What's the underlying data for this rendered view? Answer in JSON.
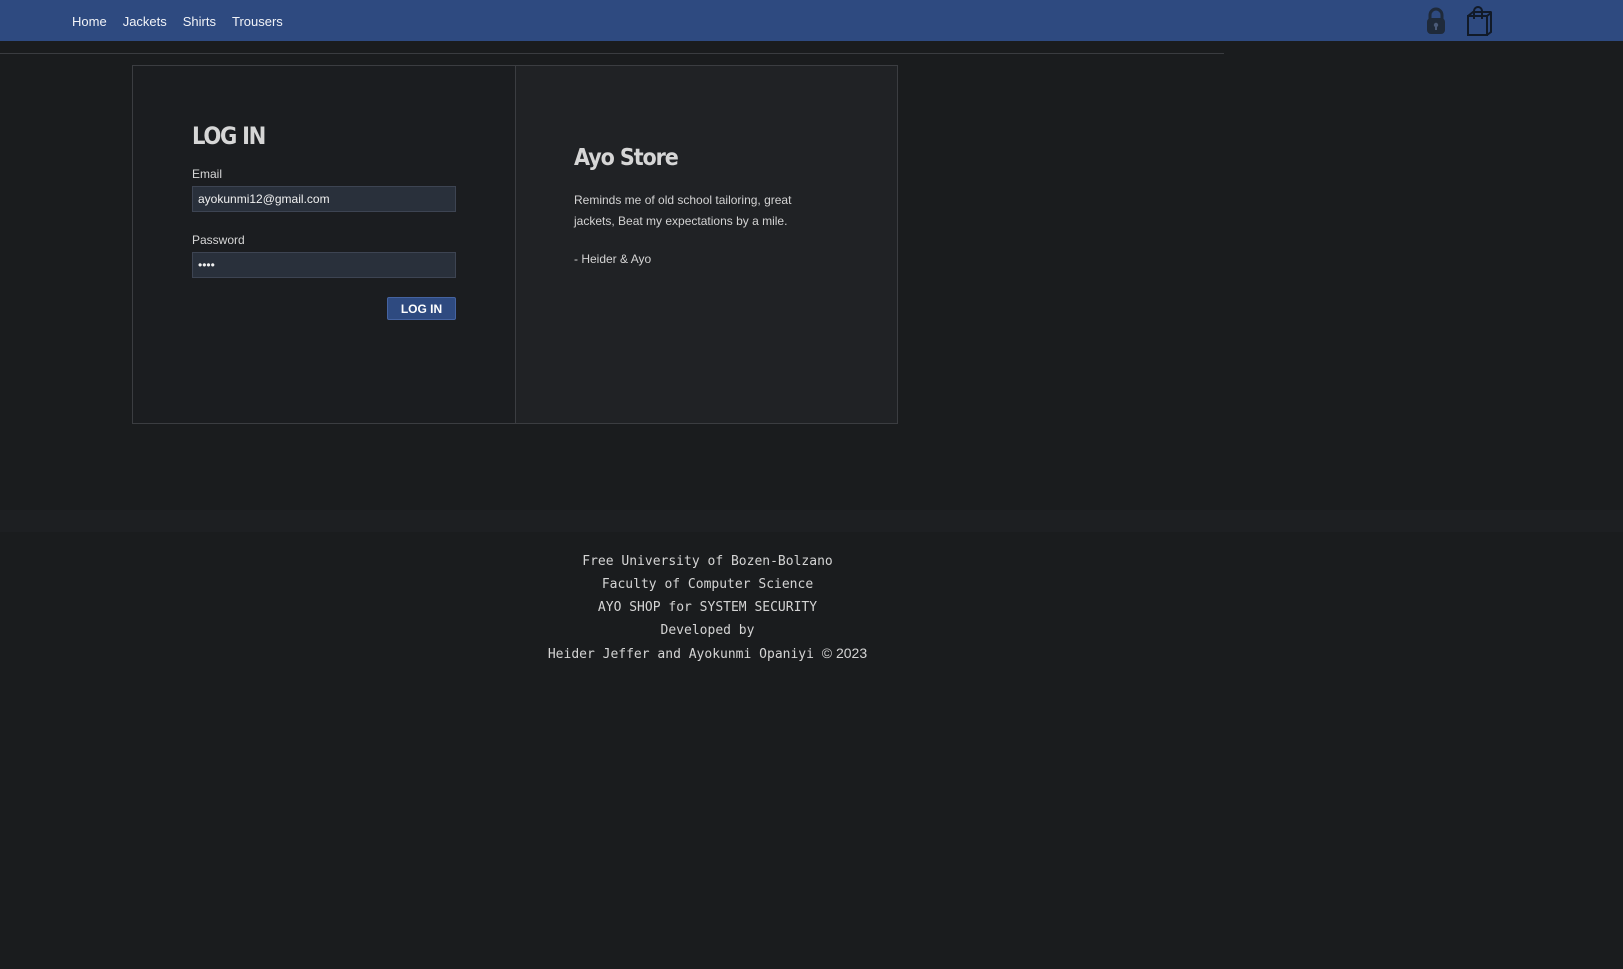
{
  "nav": {
    "items": [
      {
        "label": "Home"
      },
      {
        "label": "Jackets"
      },
      {
        "label": "Shirts"
      },
      {
        "label": "Trousers"
      }
    ],
    "icons": [
      "lock-icon",
      "shopping-bag-icon"
    ]
  },
  "login": {
    "title": "LOG IN",
    "email_label": "Email",
    "email_value": "ayokunmi12@gmail.com",
    "password_label": "Password",
    "password_value": "••••",
    "button_label": "LOG IN"
  },
  "promo": {
    "title": "Ayo Store",
    "quote": "Reminds me of old school tailoring, great jackets, Beat my expectations by a mile.",
    "author": "- Heider & Ayo"
  },
  "footer": {
    "line1": "Free University of Bozen-Bolzano",
    "line2": "Faculty of Computer Science",
    "line3": "AYO SHOP for SYSTEM SECURITY",
    "line4": "Developed by",
    "line5": "Heider Jeffer and Ayokunmi Opaniyi",
    "copyright": "© 2023"
  },
  "colors": {
    "nav_bg": "#2e4a80",
    "page_bg": "#1a1c1e",
    "accent": "#2e4a80"
  }
}
